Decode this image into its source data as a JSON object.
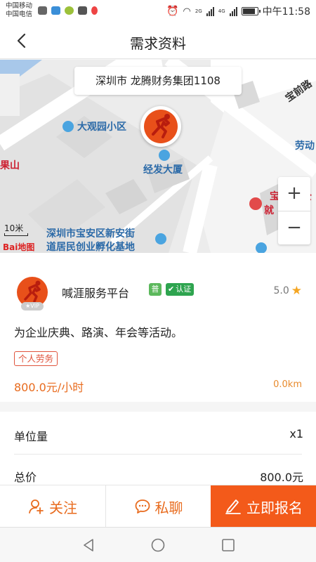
{
  "status": {
    "carrier1": "中国移动",
    "carrier2": "中国电信",
    "net1": "2G",
    "net2": "4G",
    "time": "中午11:58"
  },
  "header": {
    "title": "需求资料"
  },
  "map": {
    "address": "深圳市 龙腾财务集团1108",
    "pois": {
      "daguanyuan": "大观园小区",
      "jingfa": "经发大厦",
      "incubator_line1": "深圳市宝安区新安街",
      "incubator_line2": "道居民创业孵化基地",
      "guoshan": "果山",
      "baoqian": "宝前路",
      "laodong": "劳动",
      "bao": "宝",
      "gong": "公",
      "jiu": "就"
    },
    "zoom_in": "+",
    "zoom_out": "−",
    "scale": "10米",
    "logo": "Bai地图"
  },
  "provider": {
    "name": "喊涯服务平台",
    "badge": "普",
    "cert": "认证",
    "vip": "VIP",
    "rating": "5.0"
  },
  "demand": {
    "description": "为企业庆典、路演、年会等活动。",
    "tag": "个人劳务",
    "price": "800.0元/小时",
    "distance": "0.0km"
  },
  "details": {
    "unit_label": "单位量",
    "unit_value": "x1",
    "total_label": "总价",
    "total_value": "800.0元"
  },
  "actions": {
    "follow": "关注",
    "chat": "私聊",
    "signup": "立即报名"
  },
  "colors": {
    "accent": "#e86b1e",
    "primary_button": "#f35a1a",
    "map_bg": "#ececec",
    "poi_blue": "#2b6aa8"
  }
}
